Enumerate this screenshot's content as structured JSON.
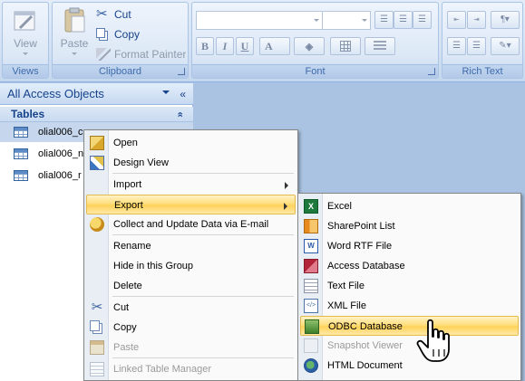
{
  "ribbon": {
    "views": {
      "view_label": "View",
      "group_label": "Views"
    },
    "clipboard": {
      "paste_label": "Paste",
      "cut_label": "Cut",
      "copy_label": "Copy",
      "format_painter_label": "Format Painter",
      "group_label": "Clipboard"
    },
    "font": {
      "group_label": "Font",
      "bold": "B",
      "italic": "I",
      "underline": "U",
      "font_color": "A"
    },
    "rich_text": {
      "group_label": "Rich Text"
    }
  },
  "nav": {
    "header": "All Access Objects",
    "shutter_glyph": "«",
    "group": "Tables",
    "collapse_glyph": "«",
    "items": [
      {
        "label": "olial006_c"
      },
      {
        "label": "olial006_n"
      },
      {
        "label": "olial006_r"
      }
    ]
  },
  "context_menu": {
    "items": [
      {
        "label": "Open",
        "icon": "open-icon"
      },
      {
        "label": "Design View",
        "icon": "design-view-icon"
      },
      {
        "label": "Import"
      },
      {
        "label": "Export"
      },
      {
        "label": "Collect and Update Data via E-mail",
        "icon": "collect-data-icon"
      },
      {
        "label": "Rename"
      },
      {
        "label": "Hide in this Group"
      },
      {
        "label": "Delete"
      },
      {
        "label": "Cut",
        "icon": "cut-icon"
      },
      {
        "label": "Copy",
        "icon": "copy-icon"
      },
      {
        "label": "Paste",
        "icon": "paste-icon"
      },
      {
        "label": "Linked Table Manager",
        "icon": "linked-table-manager-icon"
      }
    ]
  },
  "export_menu": {
    "items": [
      {
        "label": "Excel",
        "icon": "excel-icon"
      },
      {
        "label": "SharePoint List",
        "icon": "sharepoint-icon"
      },
      {
        "label": "Word RTF File",
        "icon": "word-icon"
      },
      {
        "label": "Access Database",
        "icon": "access-icon"
      },
      {
        "label": "Text File",
        "icon": "text-file-icon"
      },
      {
        "label": "XML File",
        "icon": "xml-icon"
      },
      {
        "label": "ODBC Database",
        "icon": "odbc-icon"
      },
      {
        "label": "Snapshot Viewer",
        "icon": "snapshot-icon"
      },
      {
        "label": "HTML Document",
        "icon": "html-icon"
      }
    ]
  },
  "colors": {
    "highlight": "#ffd35a",
    "ribbon": "#d4e2f4",
    "workspace": "#abc3e2"
  }
}
